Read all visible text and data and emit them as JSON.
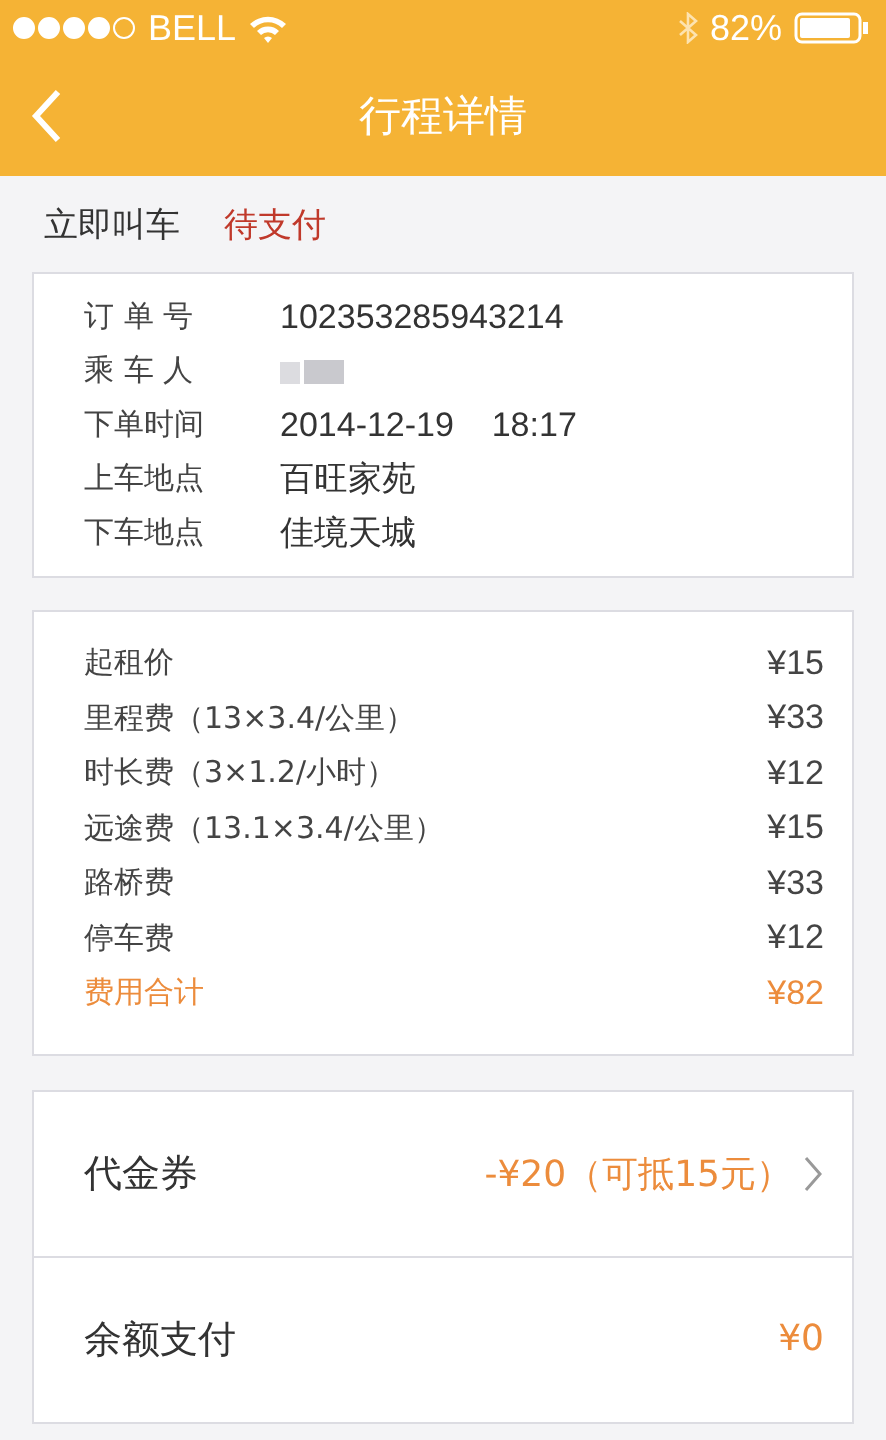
{
  "status_bar": {
    "carrier": "BELL",
    "battery": "82%"
  },
  "nav": {
    "title": "行程详情"
  },
  "header": {
    "service": "立即叫车",
    "status": "待支付"
  },
  "order_info": [
    {
      "kind": "text",
      "label": "订 单 号",
      "value": "102353285943214"
    },
    {
      "kind": "redacted",
      "label": "乘 车 人"
    },
    {
      "kind": "text",
      "label": "下单时间",
      "value": "2014-12-19    18:17"
    },
    {
      "kind": "text",
      "label": "上车地点",
      "value": "百旺家苑"
    },
    {
      "kind": "text",
      "label": "下车地点",
      "value": "佳境天城"
    }
  ],
  "fees": [
    {
      "kind": "item",
      "label": "起租价",
      "amount": "¥15"
    },
    {
      "kind": "item",
      "label": "里程费（13×3.4/公里）",
      "amount": "¥33"
    },
    {
      "kind": "item",
      "label": "时长费（3×1.2/小时）",
      "amount": "¥12"
    },
    {
      "kind": "item",
      "label": "远途费（13.1×3.4/公里）",
      "amount": "¥15"
    },
    {
      "kind": "item",
      "label": "路桥费",
      "amount": "¥33"
    },
    {
      "kind": "item",
      "label": "停车费",
      "amount": "¥12"
    },
    {
      "kind": "total",
      "label": "费用合计",
      "amount": "¥82"
    }
  ],
  "payments": [
    {
      "kind": "link",
      "label": "代金券",
      "amount": "-¥20（可抵15元）"
    },
    {
      "kind": "plain",
      "label": "余额支付",
      "amount": "¥0"
    }
  ]
}
